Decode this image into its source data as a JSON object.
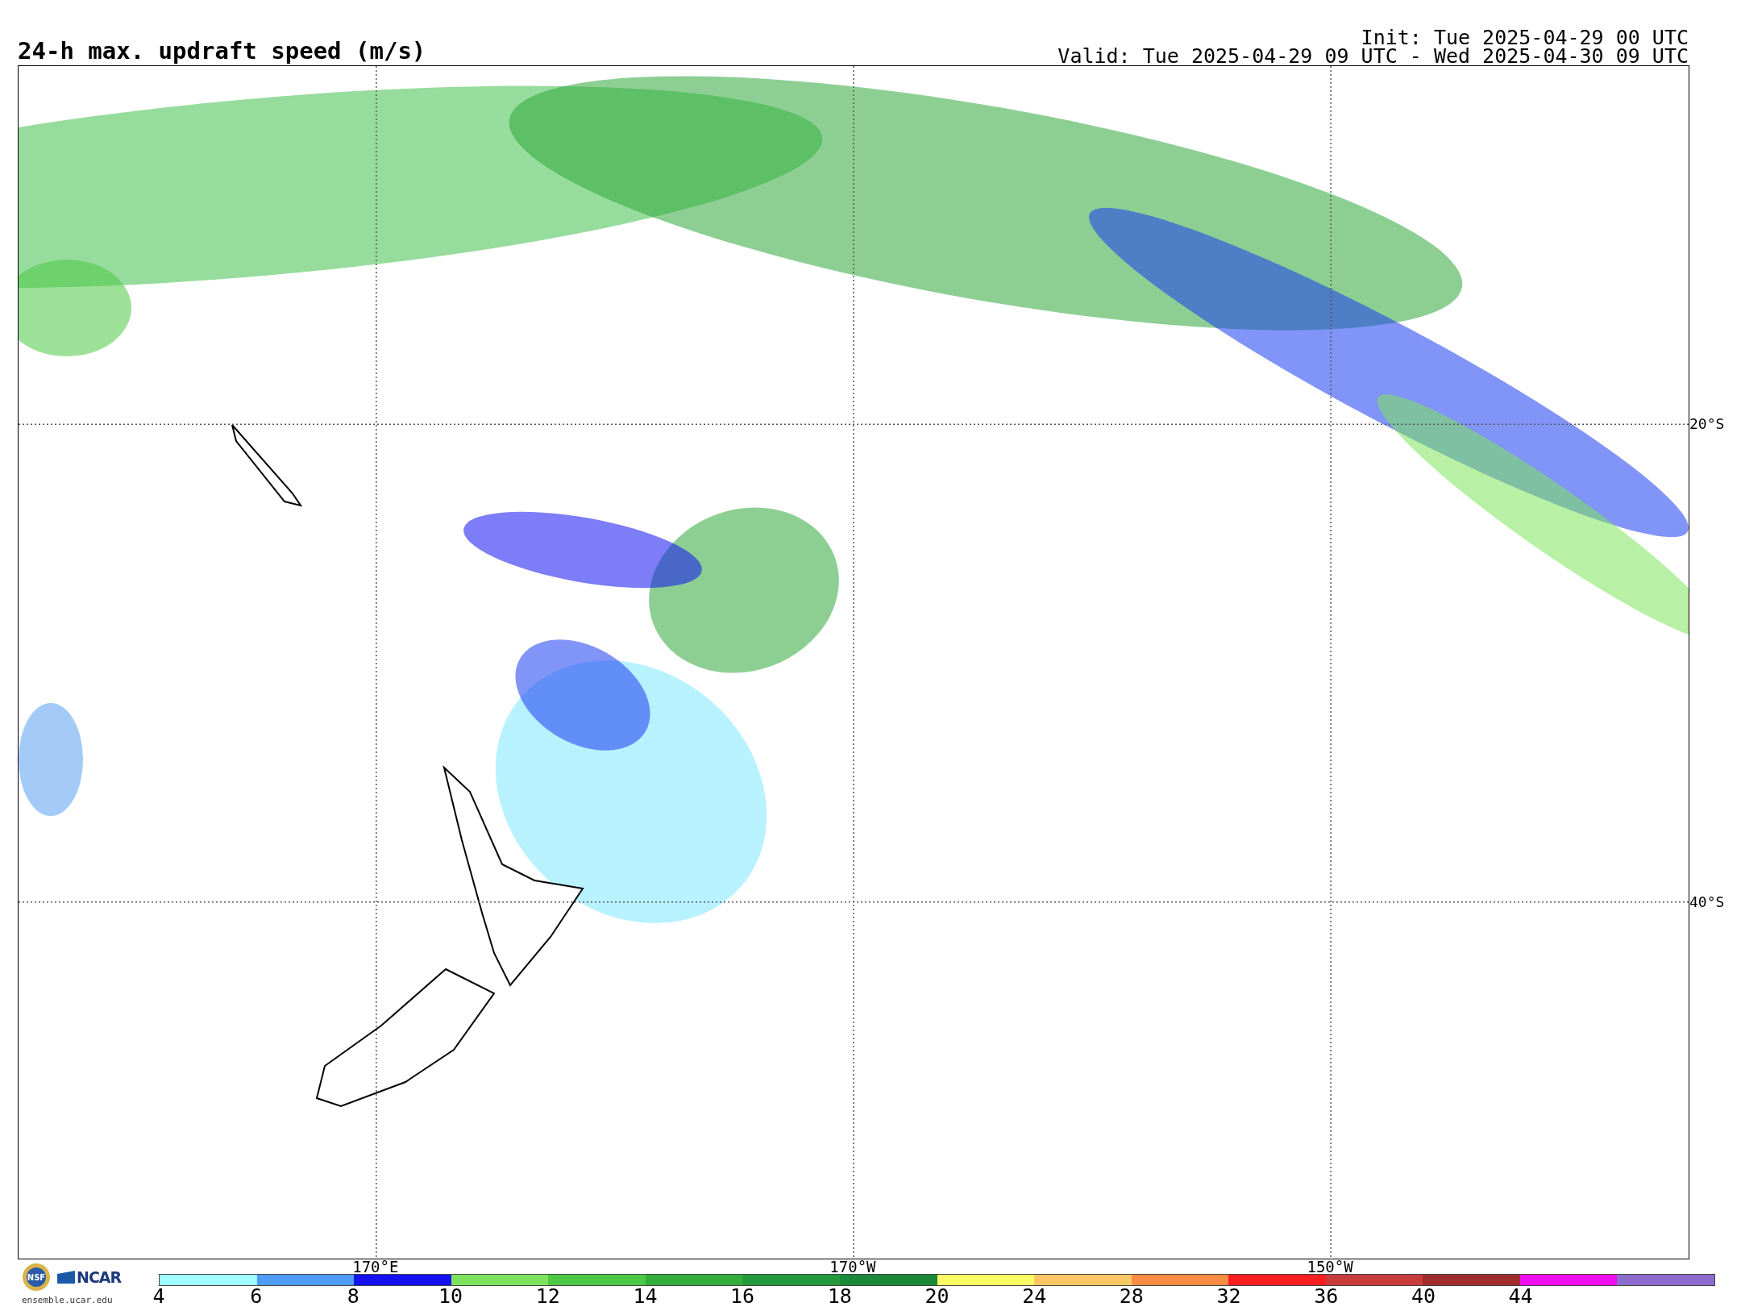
{
  "title": "24-h max. updraft speed (m/s)",
  "init": "Init: Tue 2025-04-29 00 UTC",
  "valid": "Valid: Tue 2025-04-29 09 UTC - Wed 2025-04-30 09 UTC",
  "map": {
    "lat_labels": [
      "20°S",
      "40°S"
    ],
    "lon_labels": [
      "170°E",
      "170°W",
      "150°W"
    ]
  },
  "logos": {
    "nsf": "NSF",
    "ncar": "NCAR",
    "url": "ensemble.ucar.edu"
  },
  "colorbar": {
    "segments": [
      {
        "color": "#a0ffff"
      },
      {
        "color": "#4f9cf7"
      },
      {
        "color": "#1212f0"
      },
      {
        "color": "#7ee35c"
      },
      {
        "color": "#4cc845"
      },
      {
        "color": "#33ac3a"
      },
      {
        "color": "#239a3c"
      },
      {
        "color": "#1a8a3a"
      },
      {
        "color": "#fafa64"
      },
      {
        "color": "#fbc865"
      },
      {
        "color": "#fb8c46"
      },
      {
        "color": "#fa1e1e"
      },
      {
        "color": "#c83c3c"
      },
      {
        "color": "#a02d2d"
      },
      {
        "color": "#f00ef0"
      },
      {
        "color": "#8c6ccc"
      }
    ],
    "ticks": [
      "4",
      "6",
      "8",
      "10",
      "12",
      "14",
      "16",
      "18",
      "20",
      "24",
      "28",
      "32",
      "36",
      "40",
      "44"
    ]
  }
}
